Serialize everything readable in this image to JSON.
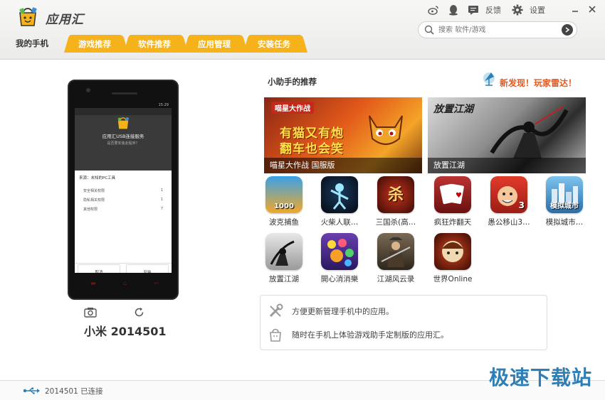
{
  "app": {
    "title": "应用汇"
  },
  "toolbar": {
    "feedback_label": "反馈",
    "settings_label": "设置"
  },
  "search": {
    "placeholder": "搜索 软件/游戏"
  },
  "nav": {
    "mine_label": "我的手机",
    "tabs": [
      "游戏推荐",
      "软件推荐",
      "应用管理",
      "安装任务"
    ]
  },
  "phone": {
    "name": "小米 2014501",
    "status_time": "15:29",
    "dialog_title": "应用汇USB连接服务",
    "dialog_sub": "是否要安装此程序？",
    "dialog_from": "来源：未知的PC工具",
    "permissions": [
      {
        "label": "安全相关权限",
        "count": "1"
      },
      {
        "label": "隐私相关权限",
        "count": "1"
      },
      {
        "label": "其他权限",
        "count": "7"
      }
    ],
    "cancel_label": "取消",
    "install_label": "安装"
  },
  "recommend": {
    "title": "小助手的推荐",
    "discover_link": "新发现！玩家雷达！",
    "banners": [
      {
        "caption": "喵星大作战 国服版",
        "badge": "喵星大作战",
        "line1": "有猫又有炮",
        "line2": "翻车也会笑"
      },
      {
        "caption": "放置江湖",
        "headline": "放置江湖"
      }
    ],
    "apps": [
      {
        "name": "波克捕鱼",
        "badge": "1000"
      },
      {
        "name": "火柴人联…",
        "badge": ""
      },
      {
        "name": "三国杀(高…",
        "badge": "杀"
      },
      {
        "name": "疯狂炸翻天",
        "badge": ""
      },
      {
        "name": "愚公移山3…",
        "badge": "3"
      },
      {
        "name": "模拟城市…",
        "badge": "模拟城市"
      },
      {
        "name": "放置江湖",
        "badge": ""
      },
      {
        "name": "開心消消樂",
        "badge": ""
      },
      {
        "name": "江湖风云录",
        "badge": ""
      },
      {
        "name": "世界Online",
        "badge": ""
      }
    ]
  },
  "tips": [
    "方便更新管理手机中的应用。",
    "随时在手机上体验游戏助手定制版的应用汇。"
  ],
  "statusbar": {
    "connection": "2014501 已连接"
  },
  "watermark": "极速下载站",
  "colors": {
    "tab": "#f6b21a",
    "accent": "#e45a22",
    "link_blue": "#2f7fb5"
  }
}
